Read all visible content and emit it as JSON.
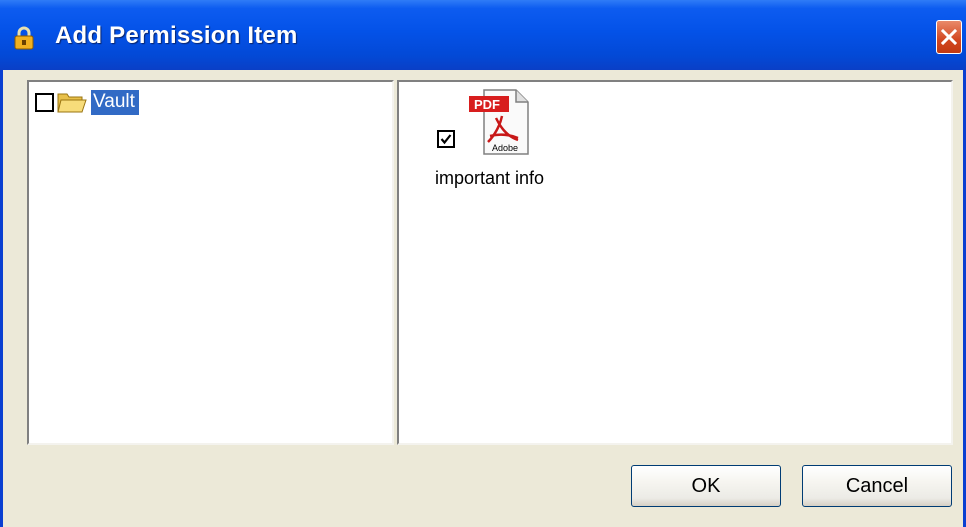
{
  "window": {
    "title": "Add Permission Item",
    "icon": "padlock-icon",
    "close_icon": "close-icon"
  },
  "tree": {
    "items": [
      {
        "label": "Vault",
        "checked": false,
        "selected": true,
        "icon": "folder-open-icon"
      }
    ]
  },
  "files": {
    "items": [
      {
        "label": "important info",
        "checked": true,
        "icon": "pdf-file-icon",
        "icon_badge": "PDF",
        "icon_caption": "Adobe"
      }
    ]
  },
  "buttons": {
    "ok_label": "OK",
    "cancel_label": "Cancel"
  },
  "colors": {
    "titlebar": "#0452e8",
    "selection": "#316ac5",
    "dialog_bg": "#ece9d8",
    "close_button": "#d2461f"
  }
}
